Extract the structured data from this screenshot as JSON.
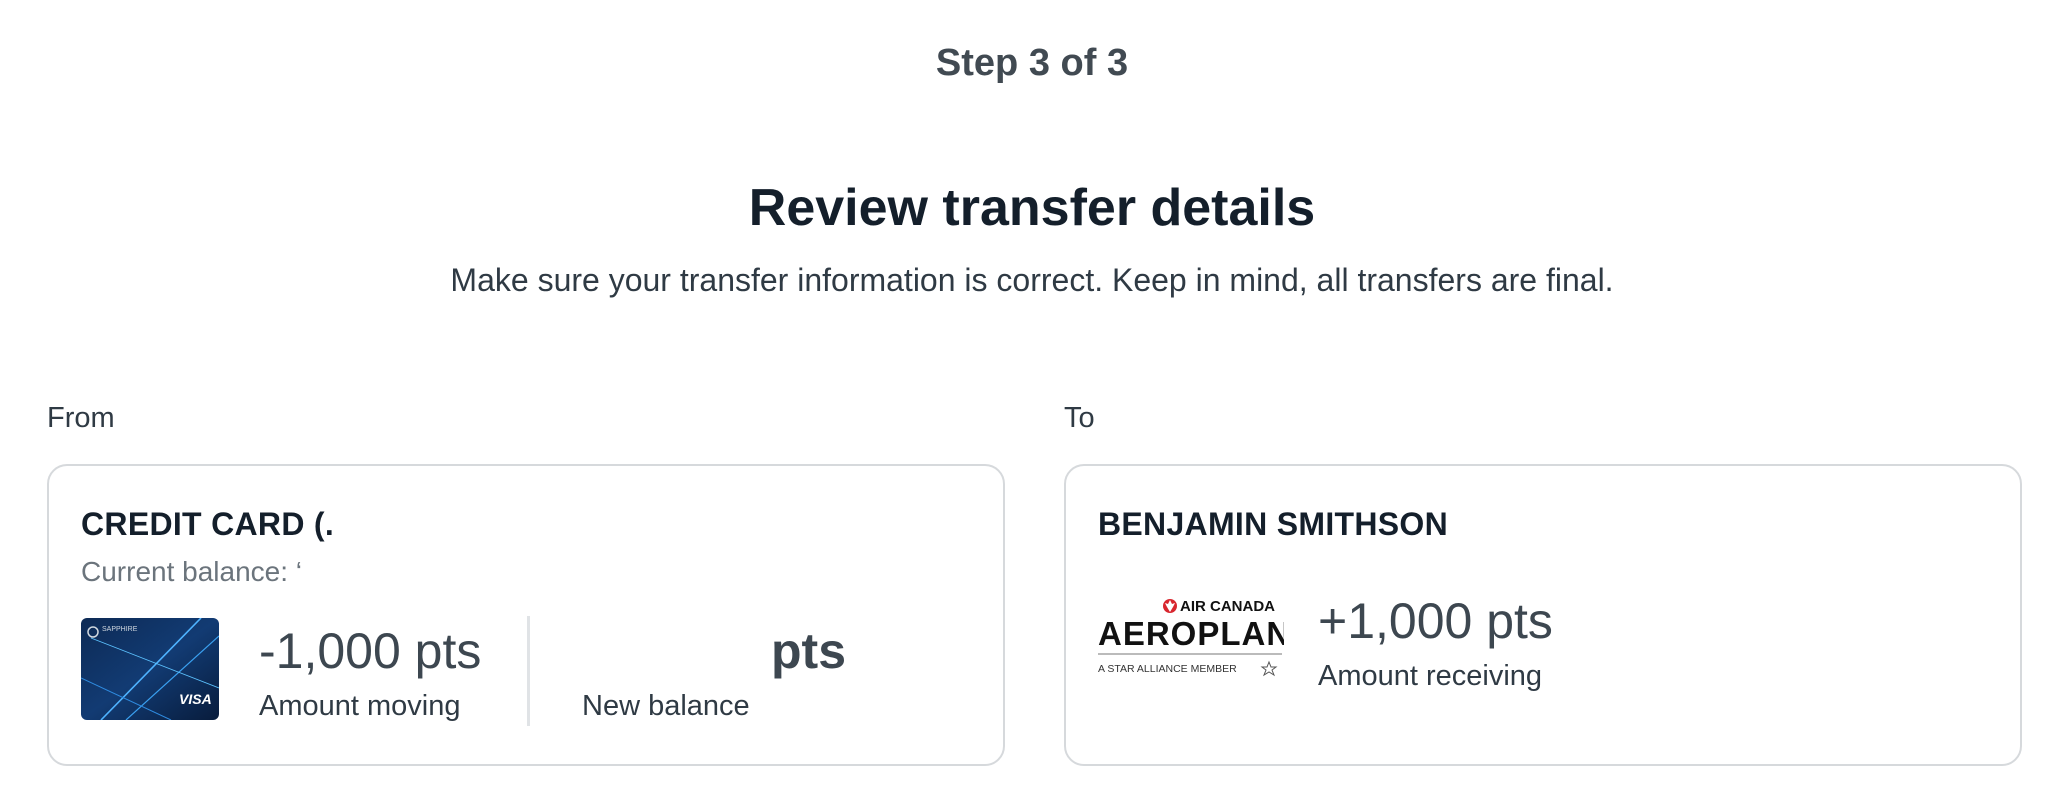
{
  "header": {
    "step": "Step 3 of 3",
    "title": "Review transfer details",
    "subtitle": "Make sure your transfer information is correct. Keep in mind, all transfers are final."
  },
  "from": {
    "section_label": "From",
    "card_title": "CREDIT CARD (.",
    "current_balance": "Current balance: ‘",
    "card_image": "sapphire-preferred-card",
    "card_brand": "VISA",
    "card_name": "SAPPHIRE",
    "amount": "-1,000 pts",
    "amount_label": "Amount moving",
    "new_balance_value": "pts",
    "new_balance_label": "New balance"
  },
  "to": {
    "section_label": "To",
    "card_title": "BENJAMIN SMITHSON",
    "logo": "air-canada-aeroplan-logo",
    "logo_top": "AIR CANADA",
    "logo_main": "AEROPLAN",
    "logo_bottom": "A STAR ALLIANCE MEMBER",
    "amount": "+1,000 pts",
    "amount_label": "Amount receiving"
  },
  "colors": {
    "card_border": "#d6d9dc",
    "heading": "#141f2b",
    "muted": "#6b747c",
    "air_canada_red": "#d8262e"
  }
}
